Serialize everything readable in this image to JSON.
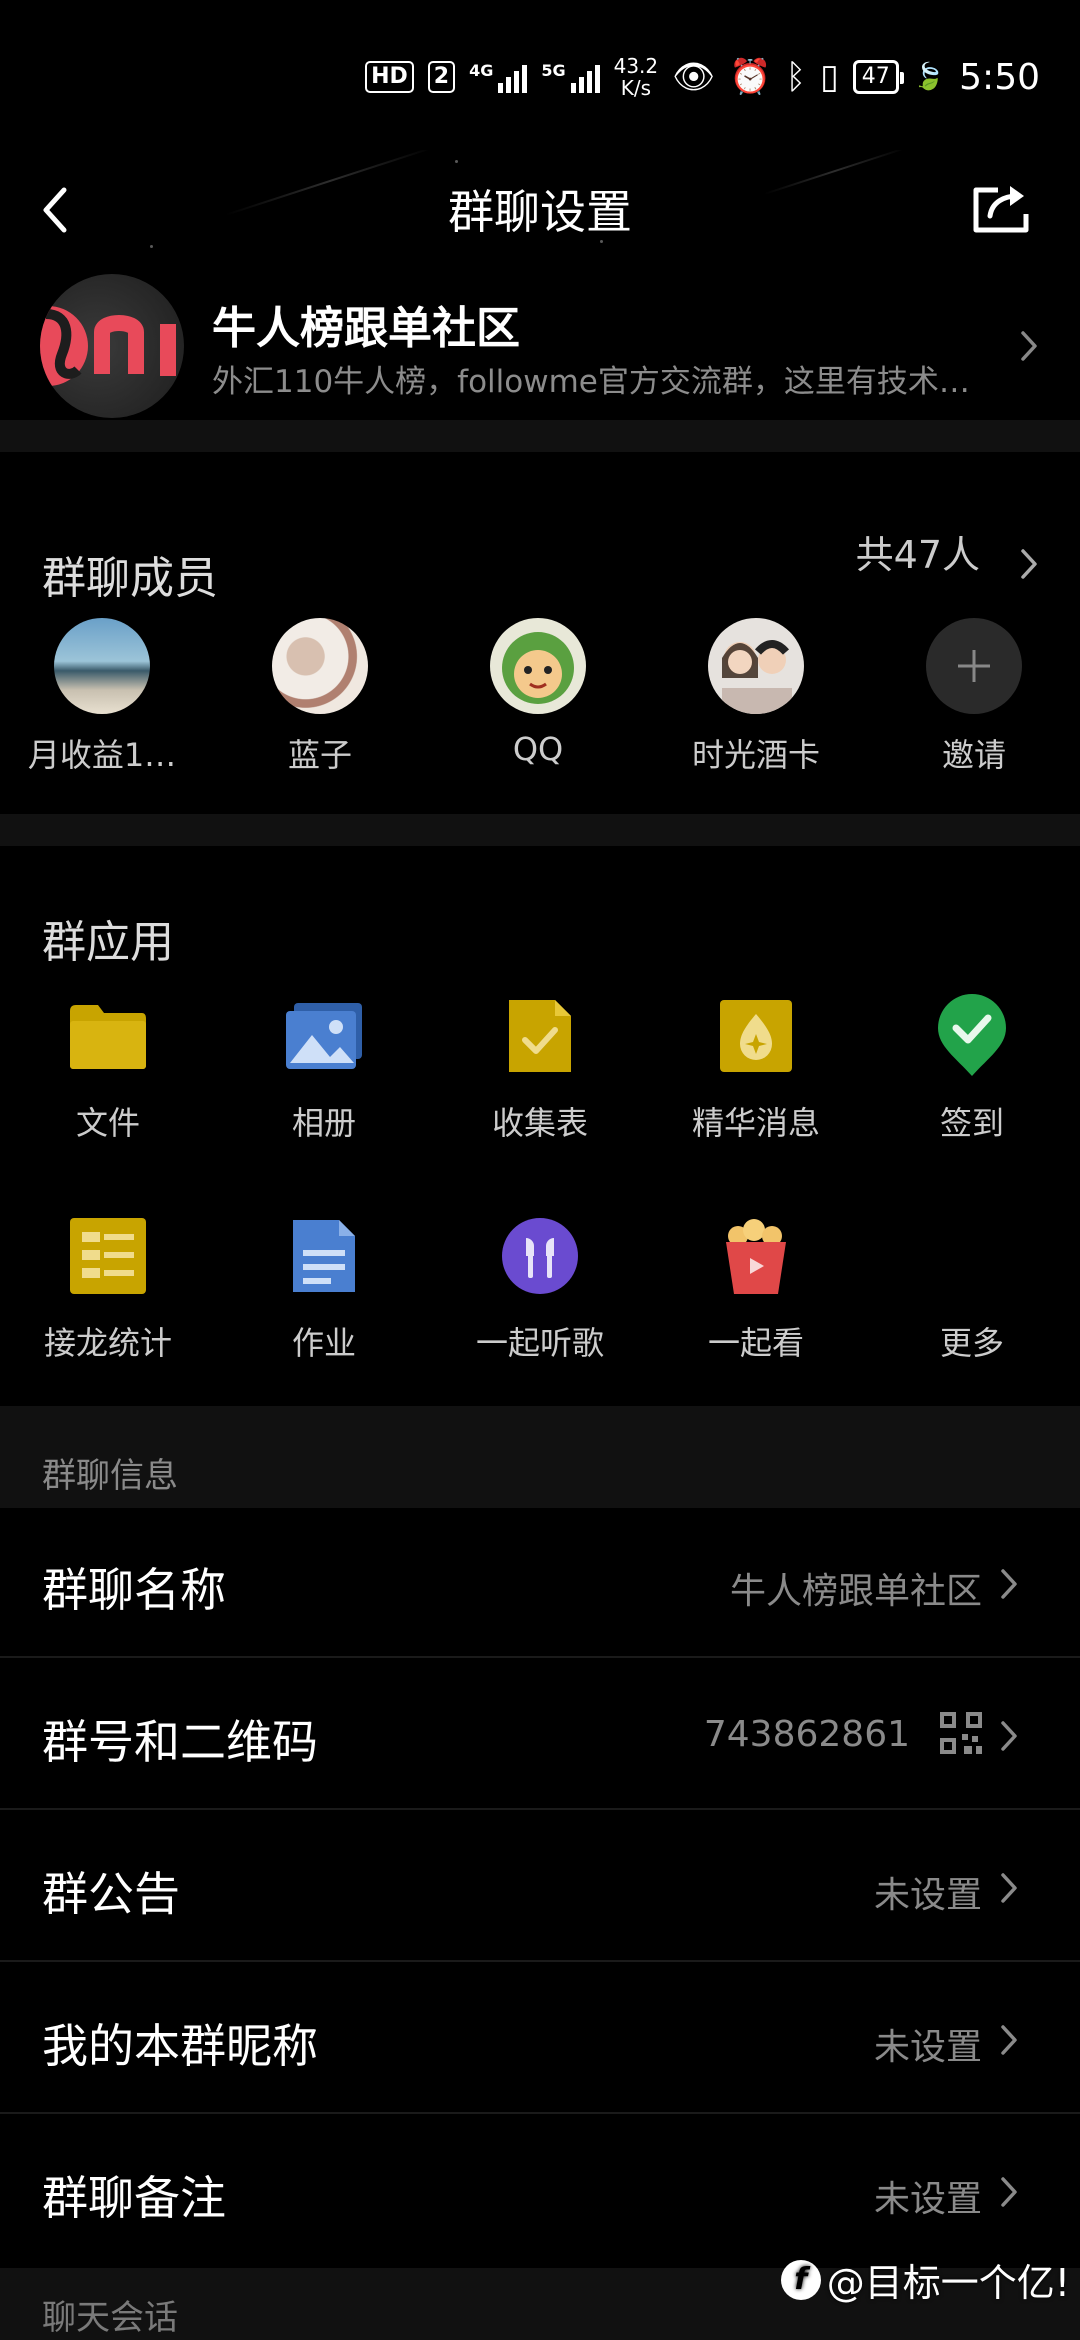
{
  "status_bar": {
    "hd_label": "HD",
    "sim_label": "2",
    "net1": "4G",
    "net2": "5G",
    "speed_value": "43.2",
    "speed_unit": "K/s",
    "battery": "47",
    "time": "5:50"
  },
  "header": {
    "title": "群聊设置"
  },
  "group": {
    "name": "牛人榜跟单社区",
    "description": "外汇110牛人榜，followme官方交流群，这里有技术…"
  },
  "members": {
    "title": "群聊成员",
    "count": "共47人",
    "list": [
      {
        "name": "月收益1…"
      },
      {
        "name": "蓝子"
      },
      {
        "name": "QQ"
      },
      {
        "name": "时光酒卡"
      },
      {
        "name": "邀请"
      }
    ]
  },
  "apps": {
    "title": "群应用",
    "items": [
      {
        "name": "文件",
        "icon": "folder-icon"
      },
      {
        "name": "相册",
        "icon": "album-icon"
      },
      {
        "name": "收集表",
        "icon": "form-icon"
      },
      {
        "name": "精华消息",
        "icon": "essence-icon"
      },
      {
        "name": "签到",
        "icon": "checkin-icon"
      },
      {
        "name": "接龙统计",
        "icon": "relay-icon"
      },
      {
        "name": "作业",
        "icon": "homework-icon"
      },
      {
        "name": "一起听歌",
        "icon": "headphones-icon"
      },
      {
        "name": "一起看",
        "icon": "popcorn-icon"
      },
      {
        "name": "更多",
        "icon": "more-icon"
      }
    ]
  },
  "info": {
    "section_title": "群聊信息",
    "rows": [
      {
        "label": "群聊名称",
        "value": "牛人榜跟单社区"
      },
      {
        "label": "群号和二维码",
        "value": "743862861"
      },
      {
        "label": "群公告",
        "value": "未设置"
      },
      {
        "label": "我的本群昵称",
        "value": "未设置"
      },
      {
        "label": "群聊备注",
        "value": "未设置"
      }
    ]
  },
  "next_section_title": "聊天会话",
  "watermark": "@目标一个亿!",
  "colors": {
    "background": "#000000",
    "section_gap": "#111111",
    "secondary_text": "#8a8a8a",
    "folder": "#c8a400",
    "album": "#4a7fd0",
    "checkin": "#22a34a",
    "headphones": "#6a4bd0",
    "popcorn": "#e04848"
  }
}
